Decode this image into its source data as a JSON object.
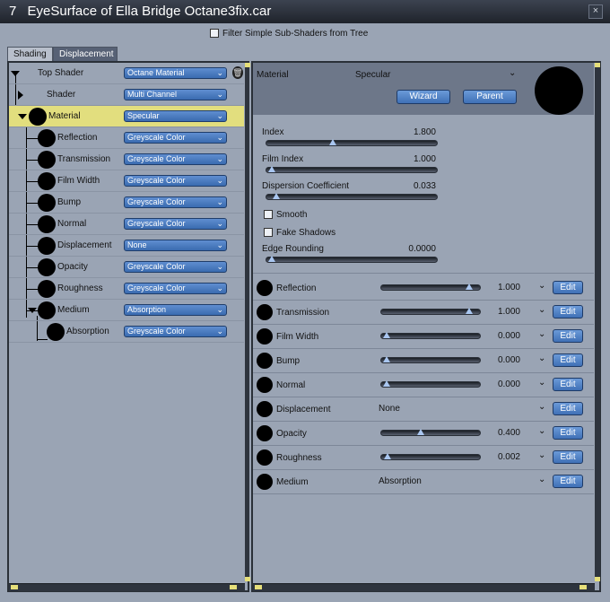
{
  "window": {
    "number": "7",
    "title": "EyeSurface of Ella Bridge Octane3fix.car",
    "close_glyph": "×"
  },
  "filter": {
    "label": "Filter Simple Sub-Shaders from Tree"
  },
  "tabs": [
    {
      "label": "Shading"
    },
    {
      "label": "Displacement"
    }
  ],
  "tree": [
    {
      "label": "Top Shader",
      "value": "Octane Material"
    },
    {
      "label": "Shader",
      "value": "Multi Channel"
    },
    {
      "label": "Material",
      "value": "Specular"
    },
    {
      "label": "Reflection",
      "value": "Greyscale Color"
    },
    {
      "label": "Transmission",
      "value": "Greyscale Color"
    },
    {
      "label": "Film Width",
      "value": "Greyscale Color"
    },
    {
      "label": "Bump",
      "value": "Greyscale Color"
    },
    {
      "label": "Normal",
      "value": "Greyscale Color"
    },
    {
      "label": "Displacement",
      "value": "None"
    },
    {
      "label": "Opacity",
      "value": "Greyscale Color"
    },
    {
      "label": "Roughness",
      "value": "Greyscale Color"
    },
    {
      "label": "Medium",
      "value": "Absorption"
    },
    {
      "label": "Absorption",
      "value": "Greyscale Color"
    }
  ],
  "material": {
    "label": "Material",
    "value": "Specular",
    "wizard": "Wizard",
    "parent": "Parent"
  },
  "props": {
    "index": {
      "label": "Index",
      "value": "1.800",
      "fraction": 0.38
    },
    "film_index": {
      "label": "Film Index",
      "value": "1.000",
      "fraction": 0.0
    },
    "dispersion": {
      "label": "Dispersion Coefficient",
      "value": "0.033",
      "fraction": 0.03
    },
    "smooth": {
      "label": "Smooth"
    },
    "fake_shadows": {
      "label": "Fake Shadows"
    },
    "edge_rounding": {
      "label": "Edge Rounding",
      "value": "0.0000",
      "fraction": 0.0
    }
  },
  "channels": [
    {
      "label": "Reflection",
      "value": "1.000",
      "fraction": 0.92,
      "edit": "Edit"
    },
    {
      "label": "Transmission",
      "value": "1.000",
      "fraction": 0.92,
      "edit": "Edit"
    },
    {
      "label": "Film Width",
      "value": "0.000",
      "fraction": 0.0,
      "edit": "Edit"
    },
    {
      "label": "Bump",
      "value": "0.000",
      "fraction": 0.0,
      "edit": "Edit"
    },
    {
      "label": "Normal",
      "value": "0.000",
      "fraction": 0.0,
      "edit": "Edit"
    },
    {
      "label": "Displacement",
      "text": "None",
      "edit": "Edit"
    },
    {
      "label": "Opacity",
      "value": "0.400",
      "fraction": 0.38,
      "edit": "Edit"
    },
    {
      "label": "Roughness",
      "value": "0.002",
      "fraction": 0.01,
      "edit": "Edit"
    },
    {
      "label": "Medium",
      "text": "Absorption",
      "edit": "Edit"
    }
  ],
  "colors": {
    "selected_row": "#e2de7e",
    "button_blue": "#4f80c4",
    "title_bg": "#2a2f38"
  }
}
